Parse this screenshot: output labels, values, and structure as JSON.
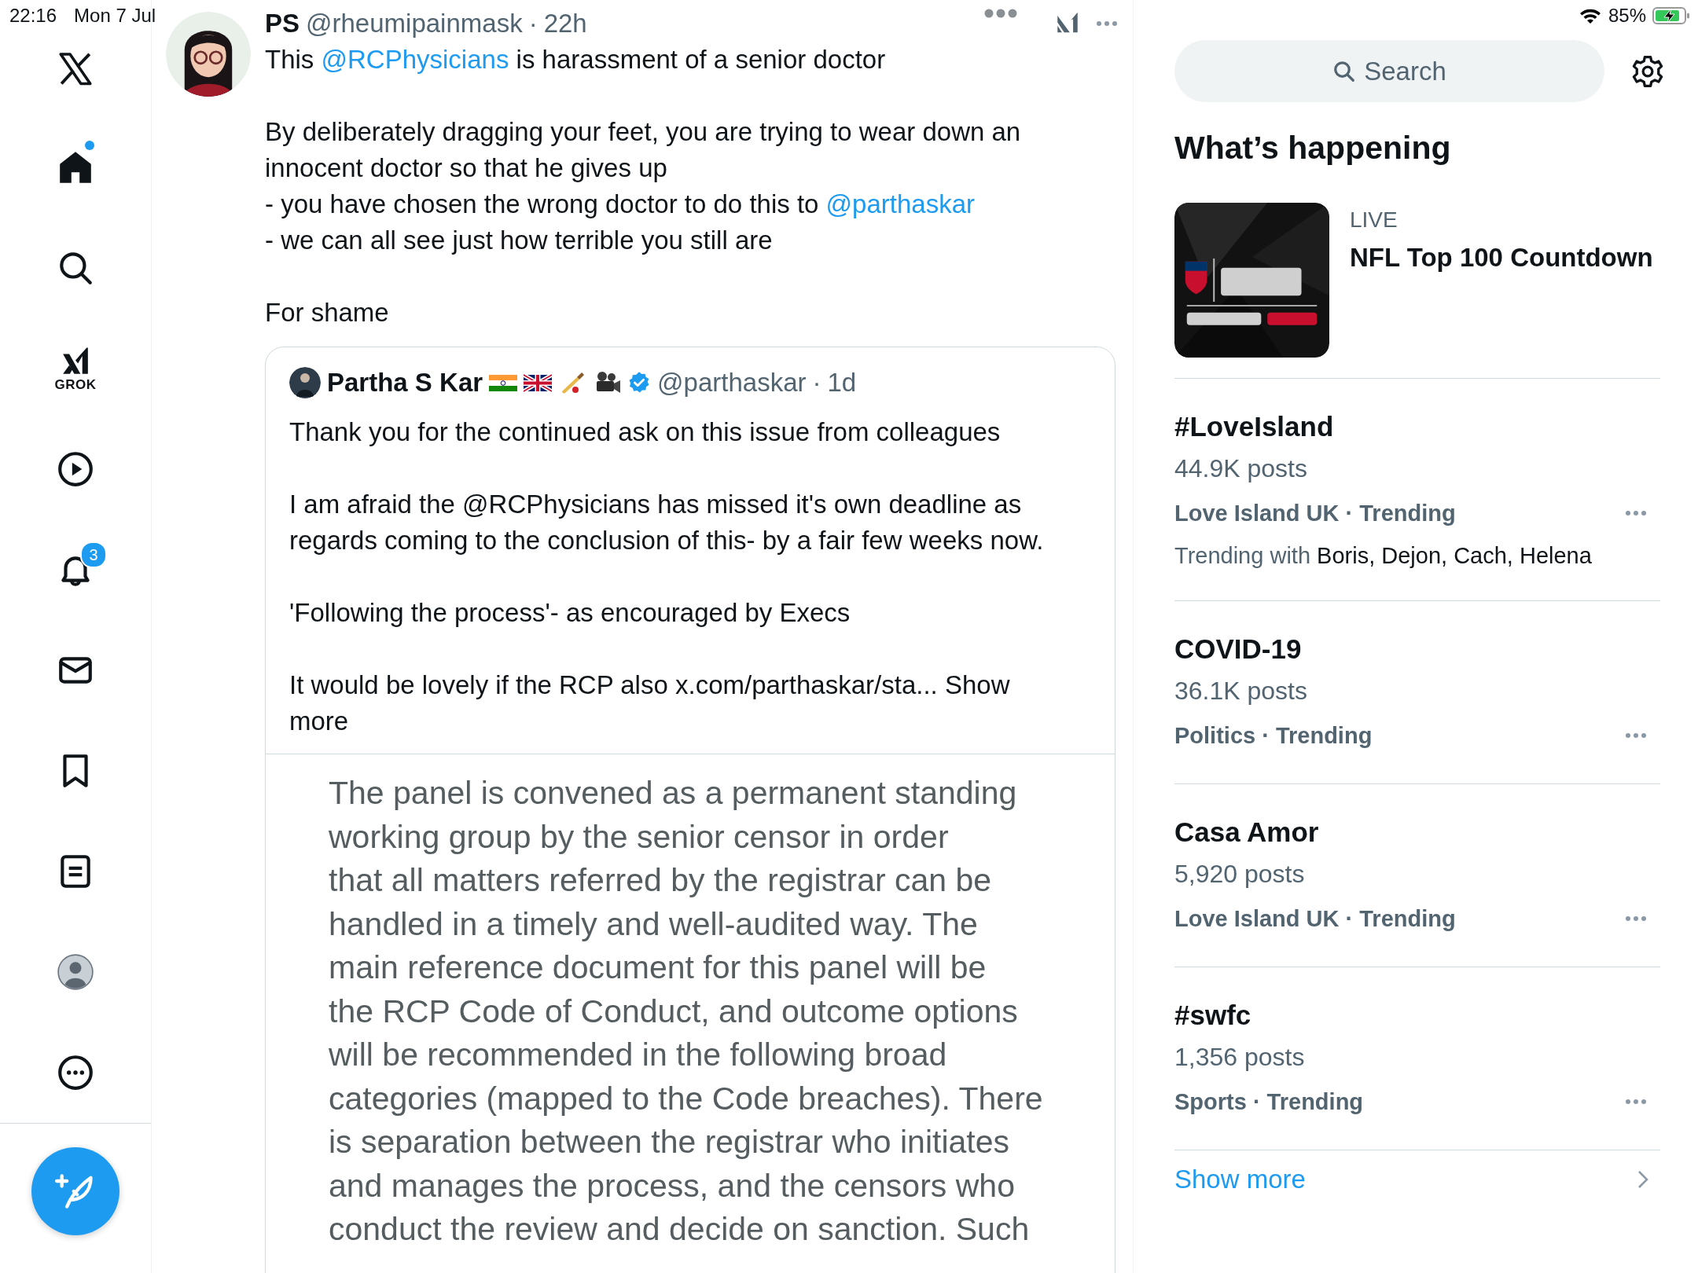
{
  "status_bar": {
    "time": "22:16",
    "date": "Mon 7 Jul",
    "battery": "85%",
    "charging": true
  },
  "sidebar": {
    "items": [
      {
        "kind": "home",
        "selected": true,
        "unread": true
      },
      {
        "kind": "search",
        "selected": false,
        "unread": false
      },
      {
        "kind": "grok",
        "label": "GROK",
        "selected": false,
        "unread": false
      },
      {
        "kind": "video",
        "selected": false,
        "unread": false
      },
      {
        "kind": "notifications",
        "badge": "3",
        "selected": false,
        "unread": false
      },
      {
        "kind": "messages",
        "selected": false,
        "unread": false
      },
      {
        "kind": "bookmarks",
        "selected": false,
        "unread": false
      },
      {
        "kind": "lists",
        "selected": false,
        "unread": false
      },
      {
        "kind": "profile",
        "selected": false,
        "unread": false
      },
      {
        "kind": "more",
        "selected": false,
        "unread": false
      }
    ]
  },
  "tweet": {
    "name": "PS",
    "handle": "@rheumipainmask",
    "separator": "·",
    "time": "22h",
    "paragraphs": [
      {
        "lines": [
          [
            {
              "text": "This "
            },
            {
              "text": "@RCPhysicians",
              "kind": "mention"
            },
            {
              "text": " is harassment of a senior doctor"
            }
          ]
        ]
      },
      {
        "lines": [
          [
            {
              "text": "By deliberately dragging your feet, you are trying to wear down an innocent doctor so that he gives up"
            }
          ],
          [
            {
              "text": "- you have chosen the wrong doctor to do this to "
            },
            {
              "text": "@parthaskar",
              "kind": "mention"
            }
          ],
          [
            {
              "text": "- we can all see just how terrible you still are"
            }
          ]
        ]
      },
      {
        "lines": [
          [
            {
              "text": "For shame"
            }
          ]
        ]
      }
    ],
    "quote": {
      "name": "Partha S Kar",
      "verified": true,
      "handle": "@parthaskar",
      "separator": "·",
      "time": "1d",
      "paragraphs": [
        "Thank you for the continued ask on this issue from colleagues",
        "I am afraid the @RCPhysicians has missed it's own deadline as regards coming to the conclusion of this- by a fair few weeks now.",
        "'Following the process'- as encouraged by Execs",
        "It would be lovely if the RCP also x.com/parthaskar/sta... Show more"
      ],
      "document_lines": [
        "The panel is convened as a permanent standing",
        "working group by the senior censor in order",
        "that all matters referred by the registrar can be",
        "handled in a timely and well-audited way. The",
        "main reference document for this panel will be",
        "the RCP Code of Conduct, and outcome options",
        "will be recommended in the following broad",
        "categories (mapped to the Code breaches). There",
        "is separation between the registrar who initiates",
        "and manages the process, and the censors who",
        "conduct the review and decide on sanction. Such"
      ]
    }
  },
  "search": {
    "placeholder": "Search"
  },
  "whats_happening": {
    "title": "What’s happening",
    "live": {
      "label": "LIVE",
      "title": "NFL Top 100 Countdown",
      "kind": "picture"
    },
    "trends": [
      {
        "title": "#LoveIsland",
        "posts": "44.9K posts",
        "meta": "Love Island UK · Trending",
        "with_label": "Trending with",
        "with_names": "Boris, Dejon, Cach, Helena"
      },
      {
        "title": "COVID-19",
        "posts": "36.1K posts",
        "meta": "Politics · Trending"
      },
      {
        "title": "Casa Amor",
        "posts": "5,920 posts",
        "meta": "Love Island UK · Trending"
      },
      {
        "title": "#swfc",
        "posts": "1,356 posts",
        "meta": "Sports · Trending"
      }
    ],
    "show_more": "Show more"
  }
}
